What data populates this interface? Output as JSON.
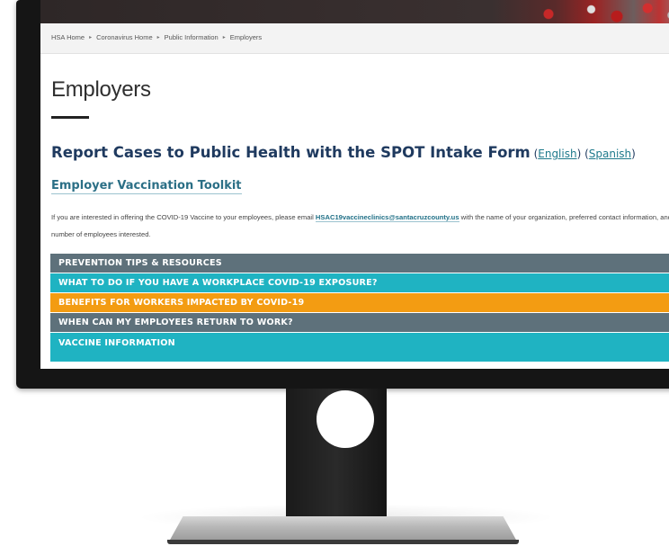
{
  "breadcrumb": [
    "HSA Home",
    "Coronavirus Home",
    "Public Information",
    "Employers"
  ],
  "breadcrumb_separator": "▸",
  "page_title": "Employers",
  "report": {
    "heading": "Report Cases to Public Health with the SPOT Intake Form",
    "open_paren_1": " (",
    "english_link": "English",
    "mid_paren": ") (",
    "spanish_link": "Spanish",
    "close_paren": ")"
  },
  "toolkit_link": "Employer Vaccination Toolkit",
  "info": {
    "before_email": "If you are interested in offering the COVID-19 Vaccine to your employees, please email ",
    "email": "HSAC19vaccineclinics@santacruzcounty.us",
    "after_email": " with the name of your organization, preferred contact information, and number of employees interested."
  },
  "accordion": [
    {
      "label": "PREVENTION TIPS & RESOURCES",
      "color": "#5e717b"
    },
    {
      "label": "WHAT TO DO IF YOU HAVE A WORKPLACE COVID-19 EXPOSURE?",
      "color": "#1fb3c2"
    },
    {
      "label": "BENEFITS FOR WORKERS IMPACTED BY COVID-19",
      "color": "#f39c12"
    },
    {
      "label": "WHEN CAN MY EMPLOYEES RETURN TO WORK?",
      "color": "#5e717b"
    },
    {
      "label": "VACCINE INFORMATION",
      "color": "#1fb3c2"
    }
  ]
}
